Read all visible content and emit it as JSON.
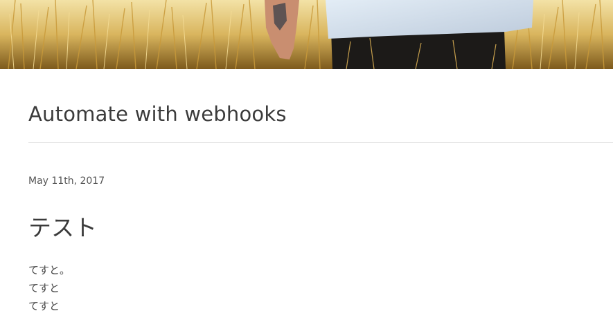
{
  "hero": {
    "image": "grass-field-person-photo"
  },
  "site": {
    "title": "Automate with webhooks"
  },
  "post": {
    "date": "May 11th, 2017",
    "title": "テスト",
    "body_lines": [
      "てすと。",
      "てすと",
      "てすと"
    ]
  }
}
